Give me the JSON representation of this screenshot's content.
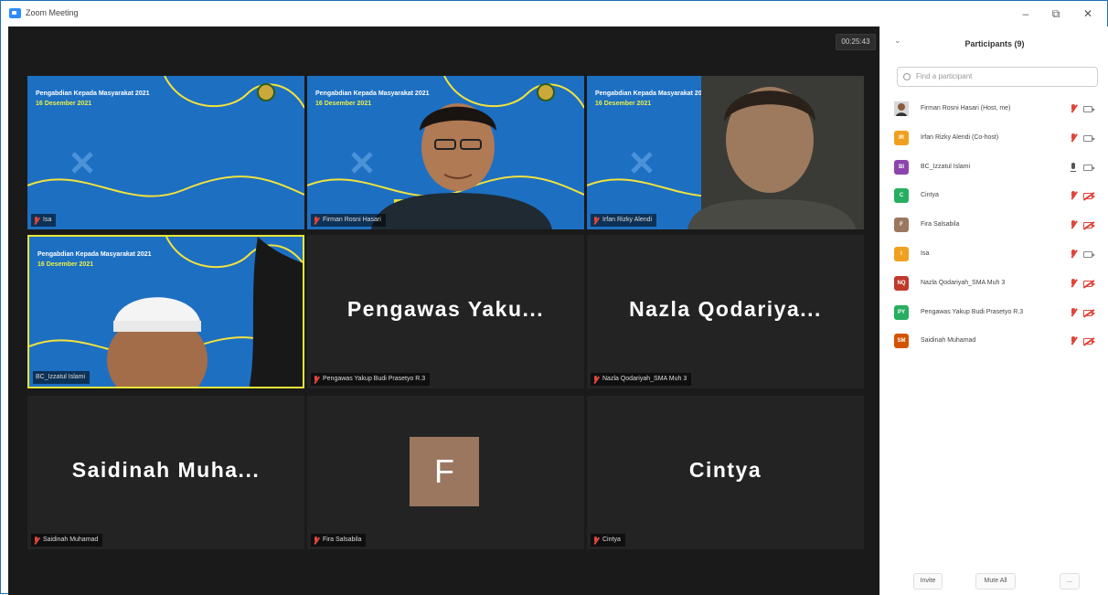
{
  "window": {
    "title": "Zoom Meeting",
    "minimize": "–",
    "restore": "⧉",
    "close": "✕"
  },
  "meeting": {
    "timer": "00:25:43",
    "banner": {
      "title": "Pengabdian Kepada Masyarakat 2021",
      "date": "16 Desember 2021"
    },
    "tiles": [
      {
        "name": "Isa",
        "style": "banner"
      },
      {
        "name": "Firman Rosni Hasari",
        "style": "banner-person"
      },
      {
        "name": "Irfan Rizky Alendi",
        "style": "banner-person2"
      },
      {
        "name": "BC_Izzatul Islami",
        "style": "banner-person3",
        "active": true
      },
      {
        "name": "Pengawas Yakup Budi Prasetyo R.3",
        "display": "Pengawas Yaku...",
        "style": "text"
      },
      {
        "name": "Nazla Qodariyah_SMA Muh 3",
        "display": "Nazla Qodariya...",
        "style": "text"
      },
      {
        "name": "Saidinah Muhamad",
        "display": "Saidinah Muha...",
        "style": "text"
      },
      {
        "name": "Fira Salsabila",
        "initial": "F",
        "style": "avatar"
      },
      {
        "name": "Cintya",
        "display": "Cintya",
        "style": "text"
      }
    ]
  },
  "participants": {
    "title": "Participants (9)",
    "search_placeholder": "Find a participant",
    "list": [
      {
        "initials": "",
        "name": "Firman Rosni Hasari (Host, me)",
        "color": "#8a6f55",
        "mic": "muted",
        "cam": "on",
        "photo": true
      },
      {
        "initials": "IR",
        "name": "Irfan Rizky Alendi (Co-host)",
        "color": "#f0a020",
        "mic": "muted",
        "cam": "on"
      },
      {
        "initials": "BI",
        "name": "BC_Izzatul Islami",
        "color": "#8e44ad",
        "mic": "on",
        "cam": "on"
      },
      {
        "initials": "C",
        "name": "Cintya",
        "color": "#27ae60",
        "mic": "muted",
        "cam": "off"
      },
      {
        "initials": "F",
        "name": "Fira Salsabila",
        "color": "#9b7760",
        "mic": "muted",
        "cam": "off"
      },
      {
        "initials": "I",
        "name": "Isa",
        "color": "#f0a020",
        "mic": "muted",
        "cam": "on"
      },
      {
        "initials": "NQ",
        "name": "Nazla Qodariyah_SMA Muh 3",
        "color": "#c0392b",
        "mic": "muted",
        "cam": "off"
      },
      {
        "initials": "PY",
        "name": "Pengawas Yakup Budi Prasetyo R.3",
        "color": "#27ae60",
        "mic": "muted",
        "cam": "off"
      },
      {
        "initials": "SM",
        "name": "Saidinah Muhamad",
        "color": "#d35400",
        "mic": "muted",
        "cam": "off"
      }
    ],
    "footer": {
      "invite": "Invite",
      "mute_all": "Mute All",
      "more": "..."
    }
  }
}
